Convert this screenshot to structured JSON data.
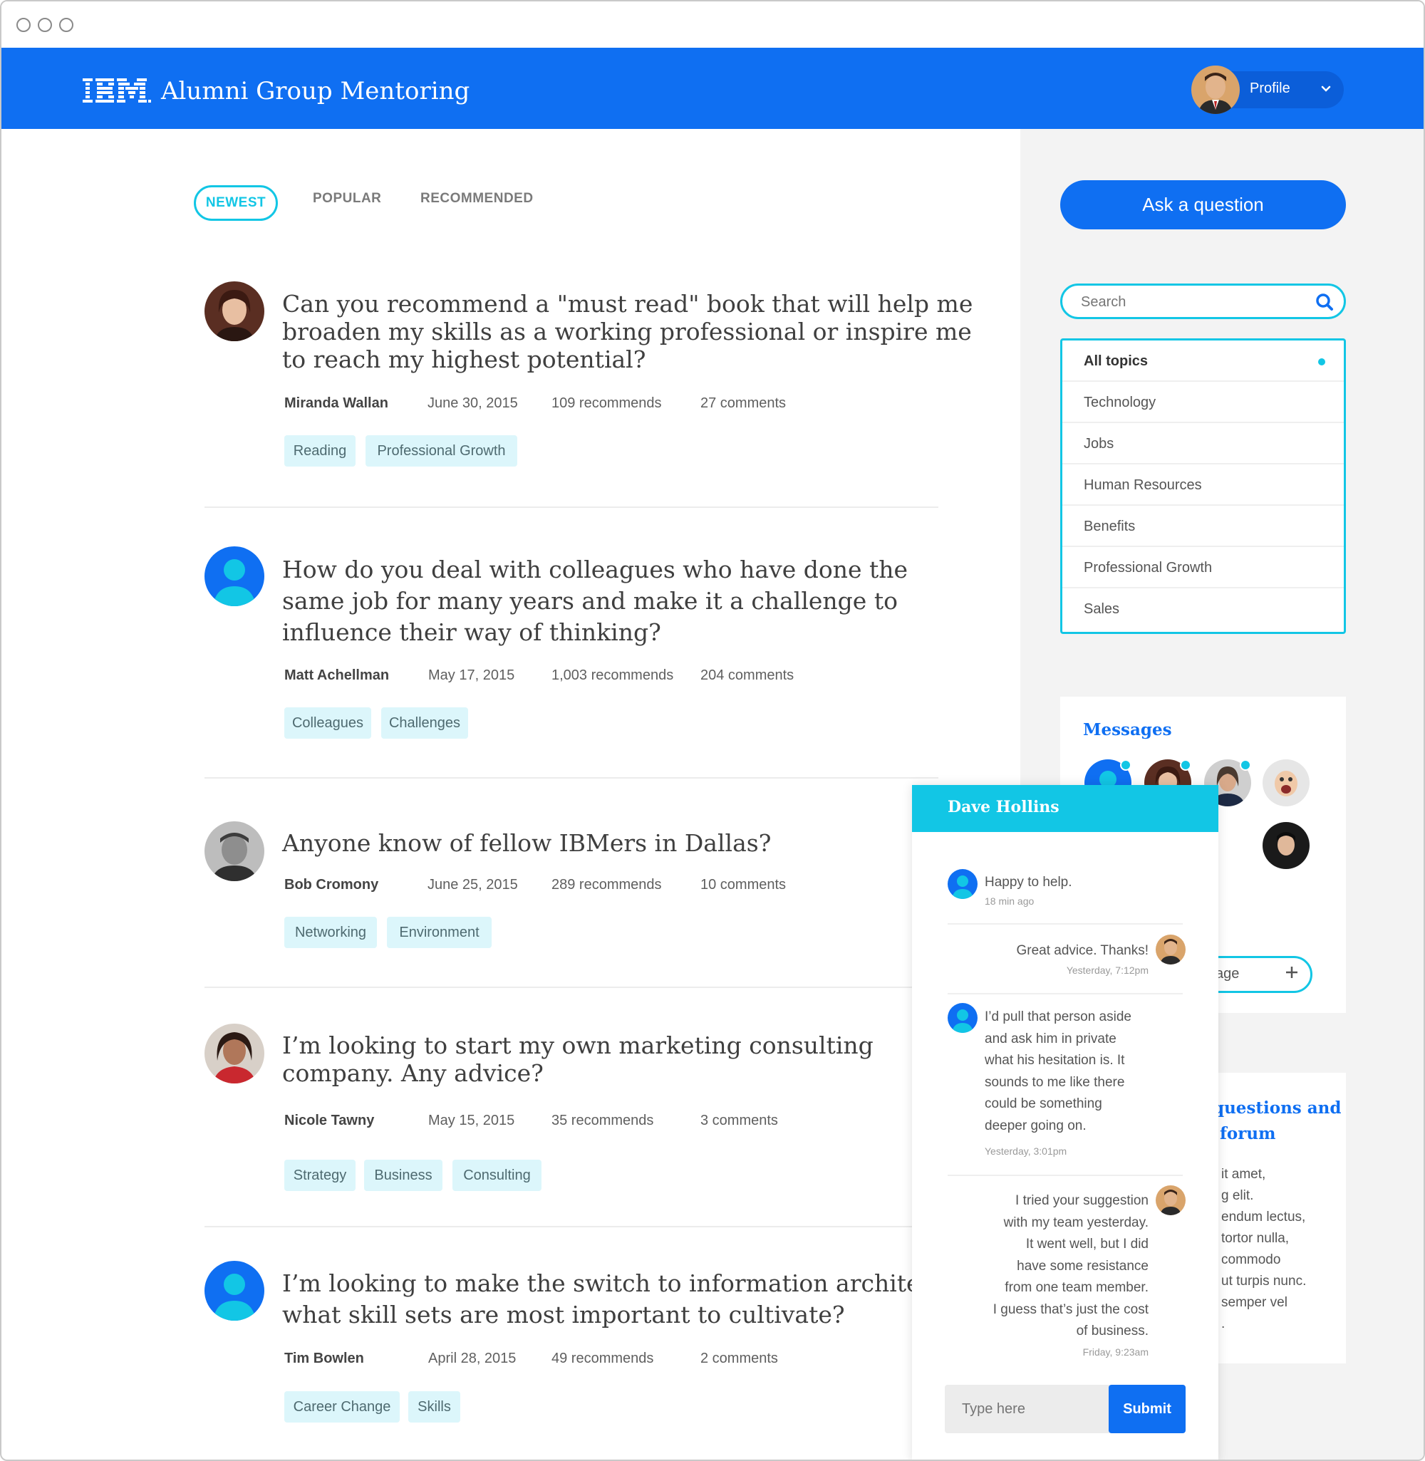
{
  "header": {
    "logo_text": "IBM",
    "title": "Alumni Group Mentoring",
    "profile_label": "Profile"
  },
  "tabs": [
    "NEWEST",
    "POPULAR",
    "RECOMMENDED"
  ],
  "posts": [
    {
      "title_lines": [
        "Can you recommend a \"must read\" book that will help me",
        "broaden my skills as a working professional or inspire me",
        "to reach my highest potential?"
      ],
      "author": "Miranda Wallan",
      "date": "June 30, 2015",
      "recommends": "109 recommends",
      "comments": "27 comments",
      "tags": [
        "Reading",
        "Professional Growth"
      ]
    },
    {
      "title_lines": [
        "How do you deal with colleagues who have done the",
        "same job for many years and make it a challenge to",
        "influence their way of thinking?"
      ],
      "author": "Matt Achellman",
      "date": "May 17, 2015",
      "recommends": "1,003 recommends",
      "comments": "204 comments",
      "tags": [
        "Colleagues",
        "Challenges"
      ]
    },
    {
      "title_lines": [
        "Anyone know of fellow IBMers in Dallas?"
      ],
      "author": "Bob Cromony",
      "date": "June 25, 2015",
      "recommends": "289 recommends",
      "comments": "10 comments",
      "tags": [
        "Networking",
        "Environment"
      ]
    },
    {
      "title_lines": [
        "I’m looking to start my own marketing consulting",
        "company. Any advice?"
      ],
      "author": "Nicole Tawny",
      "date": "May 15, 2015",
      "recommends": "35 recommends",
      "comments": "3 comments",
      "tags": [
        "Strategy",
        "Business",
        "Consulting"
      ]
    },
    {
      "title_lines": [
        "I’m looking to make the switch to information architect",
        "what skill sets are most important to cultivate?"
      ],
      "author": "Tim Bowlen",
      "date": "April 28, 2015",
      "recommends": "49 recommends",
      "comments": "2 comments",
      "tags": [
        "Career Change",
        "Skills"
      ]
    }
  ],
  "sidebar": {
    "ask_button": "Ask a question",
    "search_placeholder": "Search",
    "topics": [
      "All topics",
      "Technology",
      "Jobs",
      "Human Resources",
      "Benefits",
      "Professional Growth",
      "Sales"
    ],
    "messages_title": "Messages",
    "new_message_fragment": "age",
    "forum_title_lines": [
      "questions and",
      "forum"
    ],
    "forum_text_lines": [
      "it amet,",
      "g elit.",
      "endum lectus,",
      "tortor nulla,",
      "commodo",
      "ut turpis nunc.",
      "semper vel",
      "."
    ]
  },
  "chat": {
    "title": "Dave Hollins",
    "messages": [
      {
        "lines": [
          "Happy to help."
        ],
        "time": "18 min ago",
        "side": "left"
      },
      {
        "lines": [
          "Great advice. Thanks!"
        ],
        "time": "Yesterday, 7:12pm",
        "side": "right"
      },
      {
        "lines": [
          "I’d pull that person aside",
          "and ask him in private",
          "what his hesitation is. It",
          "sounds to me like there",
          "could be something",
          "deeper going on."
        ],
        "time": "Yesterday, 3:01pm",
        "side": "left"
      },
      {
        "lines": [
          "I tried your suggestion",
          "with my team yesterday.",
          "It went well, but I did",
          "have some resistance",
          "from one team member.",
          "I guess that’s just the cost",
          "of business."
        ],
        "time": "Friday, 9:23am",
        "side": "right"
      }
    ],
    "input_placeholder": "Type here",
    "submit_label": "Submit"
  },
  "colors": {
    "brand_blue": "#0f6ff2",
    "accent_cyan": "#12c6e5",
    "tag_bg": "#dcf6fb",
    "sidebar_bg": "#f3f3f3"
  },
  "icons": {
    "window_controls": [
      "window-close-icon",
      "window-minimize-icon",
      "window-zoom-icon"
    ],
    "search": "search-icon",
    "chevron": "chevron-down-icon",
    "plus": "plus-icon",
    "default_avatar": "user-icon"
  }
}
